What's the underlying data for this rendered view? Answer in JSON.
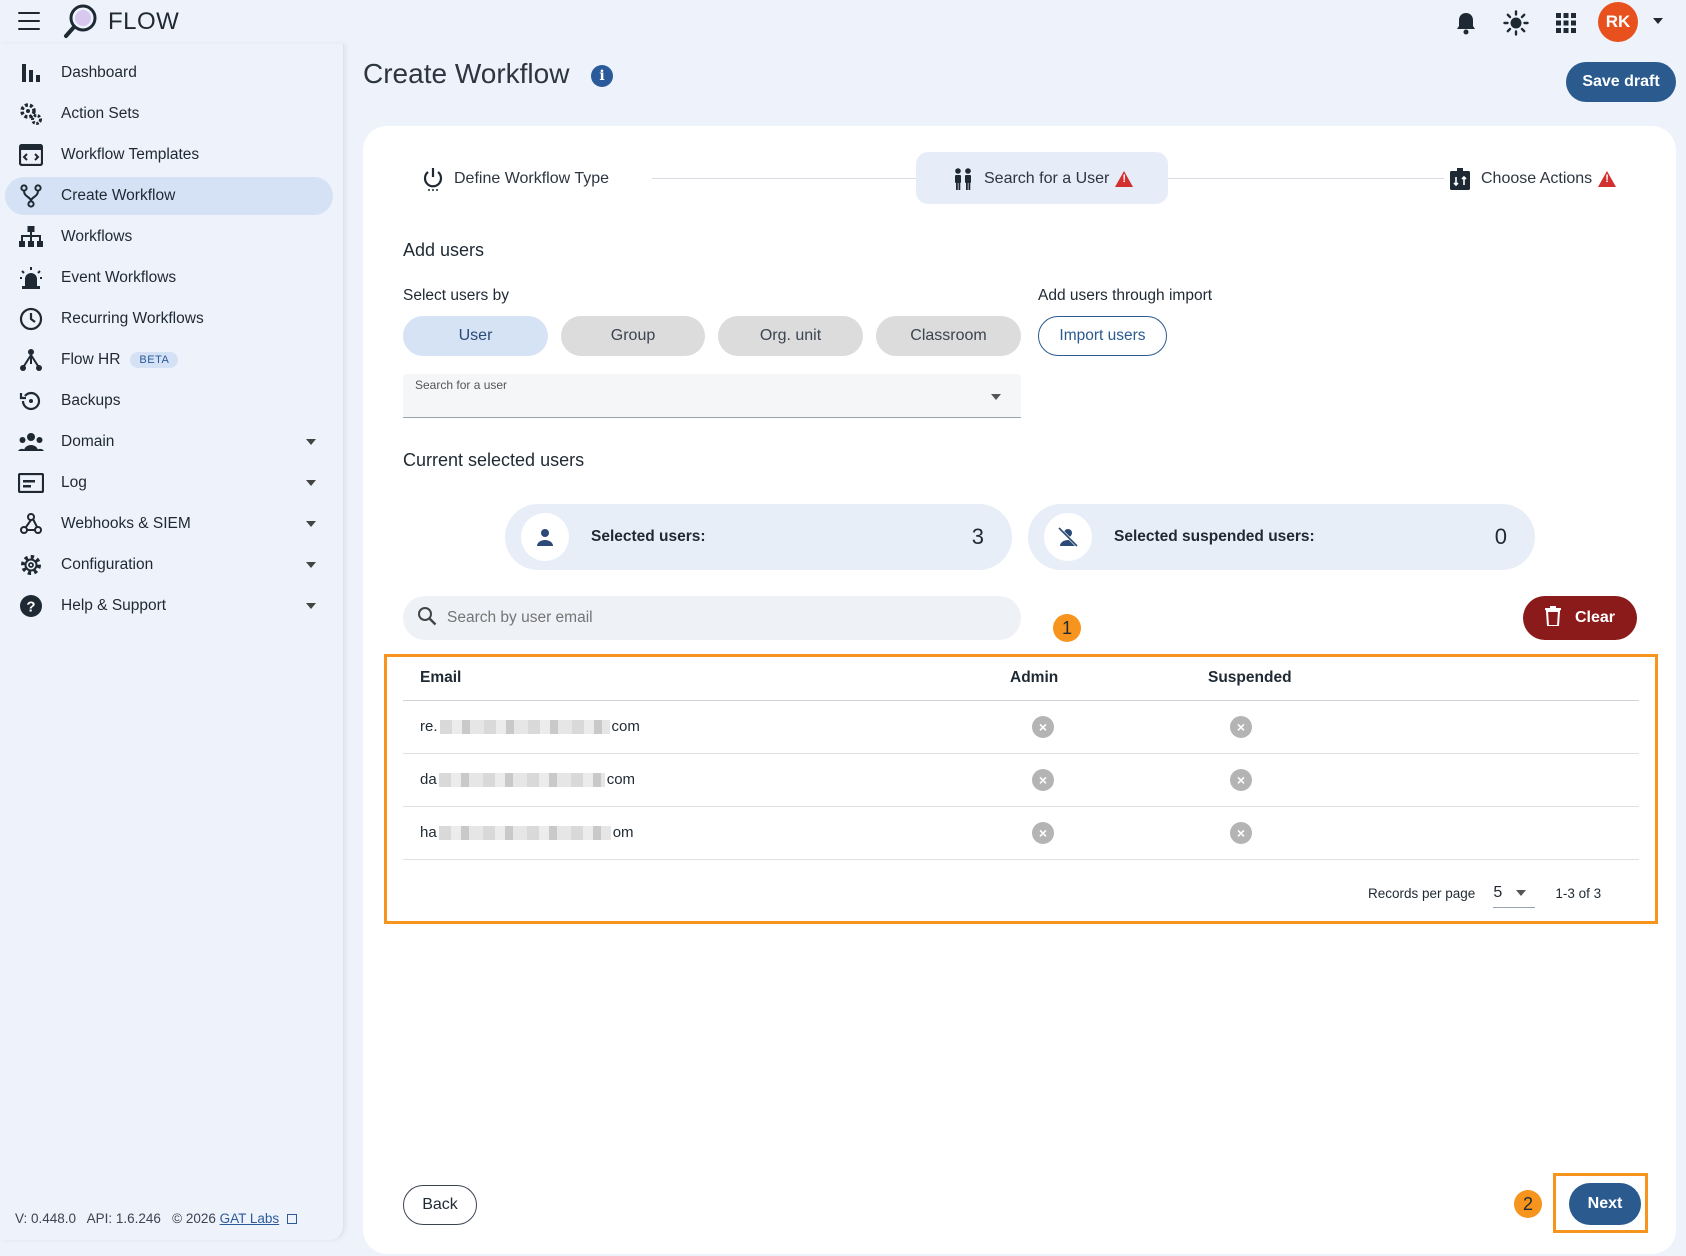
{
  "app": {
    "brand": "FLOW",
    "user_initials": "RK"
  },
  "sidebar": {
    "items": [
      {
        "label": "Dashboard",
        "icon": "bar-chart-icon"
      },
      {
        "label": "Action Sets",
        "icon": "gears-icon"
      },
      {
        "label": "Workflow Templates",
        "icon": "template-icon"
      },
      {
        "label": "Create Workflow",
        "icon": "fork-icon",
        "active": true
      },
      {
        "label": "Workflows",
        "icon": "sitemap-icon"
      },
      {
        "label": "Event Workflows",
        "icon": "alarm-light-icon"
      },
      {
        "label": "Recurring Workflows",
        "icon": "clock-icon"
      },
      {
        "label": "Flow HR",
        "icon": "hr-icon",
        "badge": "BETA"
      },
      {
        "label": "Backups",
        "icon": "restore-icon"
      },
      {
        "label": "Domain",
        "icon": "people-icon",
        "expandable": true
      },
      {
        "label": "Log",
        "icon": "log-icon",
        "expandable": true
      },
      {
        "label": "Webhooks & SIEM",
        "icon": "webhook-icon",
        "expandable": true
      },
      {
        "label": "Configuration",
        "icon": "gear-icon",
        "expandable": true
      },
      {
        "label": "Help & Support",
        "icon": "help-icon",
        "expandable": true
      }
    ],
    "version": "V: 0.448.0",
    "api": "API: 1.6.246",
    "copyright": "© 2026",
    "company_link": "GAT Labs"
  },
  "header": {
    "title": "Create Workflow",
    "save_draft": "Save draft"
  },
  "stepper": {
    "steps": [
      {
        "label": "Define Workflow Type"
      },
      {
        "label": "Search for a User",
        "active": true,
        "warning": true
      },
      {
        "label": "Choose Actions",
        "warning": true
      }
    ]
  },
  "add_users": {
    "title": "Add users",
    "select_by_label": "Select users by",
    "options": [
      "User",
      "Group",
      "Org. unit",
      "Classroom"
    ],
    "selected_option": "User",
    "import_label": "Add users through import",
    "import_button": "Import users",
    "search_label": "Search for a user"
  },
  "current": {
    "title": "Current selected users",
    "selected_label": "Selected users:",
    "selected_count": "3",
    "suspended_label": "Selected suspended users:",
    "suspended_count": "0",
    "search_placeholder": "Search by user email",
    "clear_button": "Clear"
  },
  "table": {
    "headers": [
      "Email",
      "Admin",
      "Suspended"
    ],
    "rows": [
      {
        "email_start": "re.",
        "email_end": "com"
      },
      {
        "email_start": "da",
        "email_end": "com"
      },
      {
        "email_start": "ha",
        "email_end": "om"
      }
    ],
    "records_label": "Records per page",
    "per_page": "5",
    "range": "1-3 of 3"
  },
  "annotations": {
    "marker1": "1",
    "marker2": "2"
  },
  "footer": {
    "back": "Back",
    "next": "Next"
  },
  "colors": {
    "accent": "#2b5a8f",
    "danger": "#8b1a1a",
    "highlight": "#f7941d",
    "avatar": "#e8501e"
  }
}
